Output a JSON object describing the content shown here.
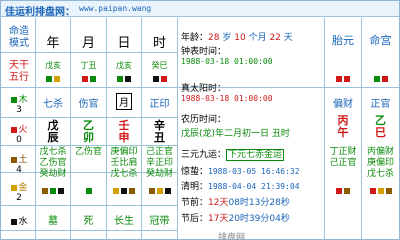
{
  "banner": {
    "site": "佳运利排盘网：",
    "url": "www.paipan.wang"
  },
  "left": {
    "mode_label": "命造\n模式",
    "row_tiangan": "天干\n五行",
    "elements": [
      {
        "name": "木",
        "count": "3"
      },
      {
        "name": "火",
        "count": "0"
      },
      {
        "name": "土",
        "count": "4"
      },
      {
        "name": "金",
        "count": "2"
      },
      {
        "name": "水",
        "count": ""
      }
    ]
  },
  "pillars": {
    "heads": [
      "年",
      "月",
      "日",
      "时"
    ],
    "ganzhi_top": [
      "戊亥",
      "丁丑",
      "戊亥",
      "癸巳"
    ],
    "tengod": [
      "七杀",
      "伤官",
      "月",
      "正印"
    ],
    "stem": [
      "戊",
      "乙",
      "壬",
      "辛"
    ],
    "branch": [
      "辰",
      "卯",
      "申",
      "丑"
    ],
    "hidden_a": [
      "戊七杀",
      "乙伤官",
      "庚偏印",
      "己正官"
    ],
    "hidden_b": [
      "乙伤官",
      "",
      "壬比肩",
      "辛正印"
    ],
    "hidden_c": [
      "癸劫财",
      "",
      "戊七杀",
      "癸劫财"
    ],
    "stage": [
      "墓",
      "死",
      "长生",
      "冠带"
    ]
  },
  "info": {
    "age_label": "年龄：",
    "age_year": "28",
    "age_unit1": "岁",
    "age_month": "10",
    "age_unit2": "个月",
    "age_day": "22",
    "age_unit3": "天",
    "clock_label": "钟表时间：",
    "clock_time": "1988-03-18 01:00:00",
    "solar_label": "真太阳时：",
    "solar_time": "1988-03-18 01:00:00",
    "lunar_label": "农历时间：",
    "lunar_time": "戊辰(龙)年二月初一日 丑时",
    "sanyuan_label": "三元九运：",
    "sanyuan_value": "下元七赤金运",
    "jingzhe_label": "惊蛰：",
    "jingzhe_time": "1988-03-05 16:46:32",
    "qingming_label": "清明：",
    "qingming_time": "1988-04-04 21:39:04",
    "past_label": "节前：",
    "past_days": "12天",
    "past_hours": "08时13分28秒",
    "next_label": "节后：",
    "next_days": "17天",
    "next_hours": "20时39分04秒",
    "footer_label": "排盘网"
  },
  "right": {
    "col1_head": "胎元",
    "col2_head": "命宫",
    "col1_tengod": "偏财",
    "col2_tengod": "正官",
    "col1_stem": "丙",
    "col1_branch": "午",
    "col2_stem": "乙",
    "col2_branch": "巳",
    "col1_hidden_a": "丁正财",
    "col1_hidden_b": "己正官",
    "col2_hidden_a": "丙偏财",
    "col2_hidden_b": "庚偏印",
    "col2_hidden_c": "戊七杀"
  },
  "colors": {
    "border": "#9cc3dc",
    "accent": "#1a64b8",
    "green": "#0a8a0a",
    "red": "#d01818"
  }
}
